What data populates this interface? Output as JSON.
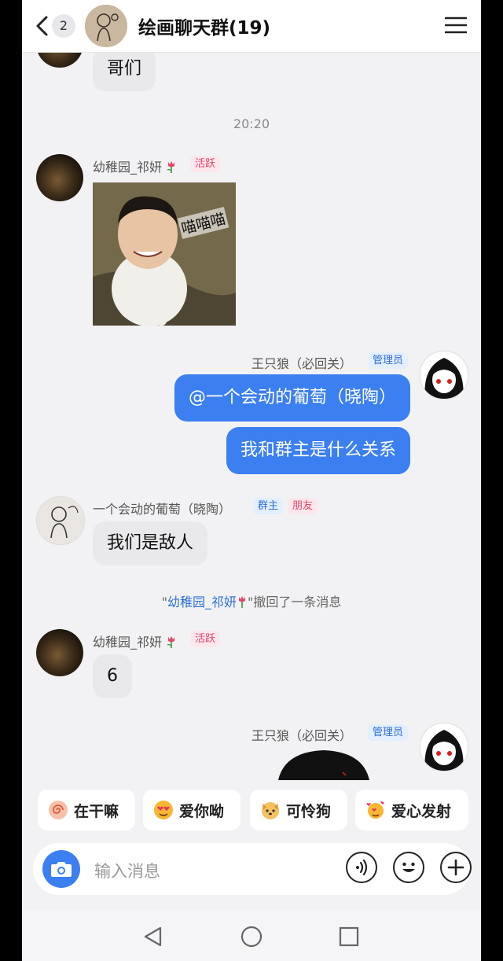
{
  "header": {
    "unread_count": "2",
    "group_name": "绘画聊天群(19)"
  },
  "messages": {
    "m1": {
      "text": "哥们"
    },
    "time1": "20:20",
    "m2": {
      "sender": "幼稚园_祁妍",
      "tag": "活跃",
      "image_caption": "喵喵喵"
    },
    "m3": {
      "sender": "王只狼（必回关）",
      "tag": "管理员",
      "text1": "@一个会动的葡萄（晓陶）",
      "text2": "我和群主是什么关系"
    },
    "m4": {
      "sender": "一个会动的葡萄（晓陶）",
      "tag1": "群主",
      "tag2": "朋友",
      "text": "我们是敌人"
    },
    "recall": {
      "quote_open": "\"",
      "who": "幼稚园_祁妍",
      "quote_close": "\"",
      "text": "撤回了一条消息"
    },
    "m5": {
      "sender": "幼稚园_祁妍",
      "tag": "活跃",
      "text": "6"
    },
    "m6": {
      "sender": "王只狼（必回关）",
      "tag": "管理员"
    }
  },
  "quick_replies": [
    {
      "label": "在干嘛",
      "icon": "swirl-emoji-icon",
      "color": "#f07050"
    },
    {
      "label": "爱你呦",
      "icon": "heart-eyes-emoji-icon",
      "color": "#f5a623"
    },
    {
      "label": "可怜狗",
      "icon": "dog-emoji-icon",
      "color": "#f5a623"
    },
    {
      "label": "爱心发射",
      "icon": "hearts-emoji-icon",
      "color": "#f5a623"
    }
  ],
  "input": {
    "placeholder": "输入消息"
  },
  "colors": {
    "accent": "#3b7ff0",
    "active_tag": "#e8456b",
    "admin_tag": "#2e6fd8"
  }
}
